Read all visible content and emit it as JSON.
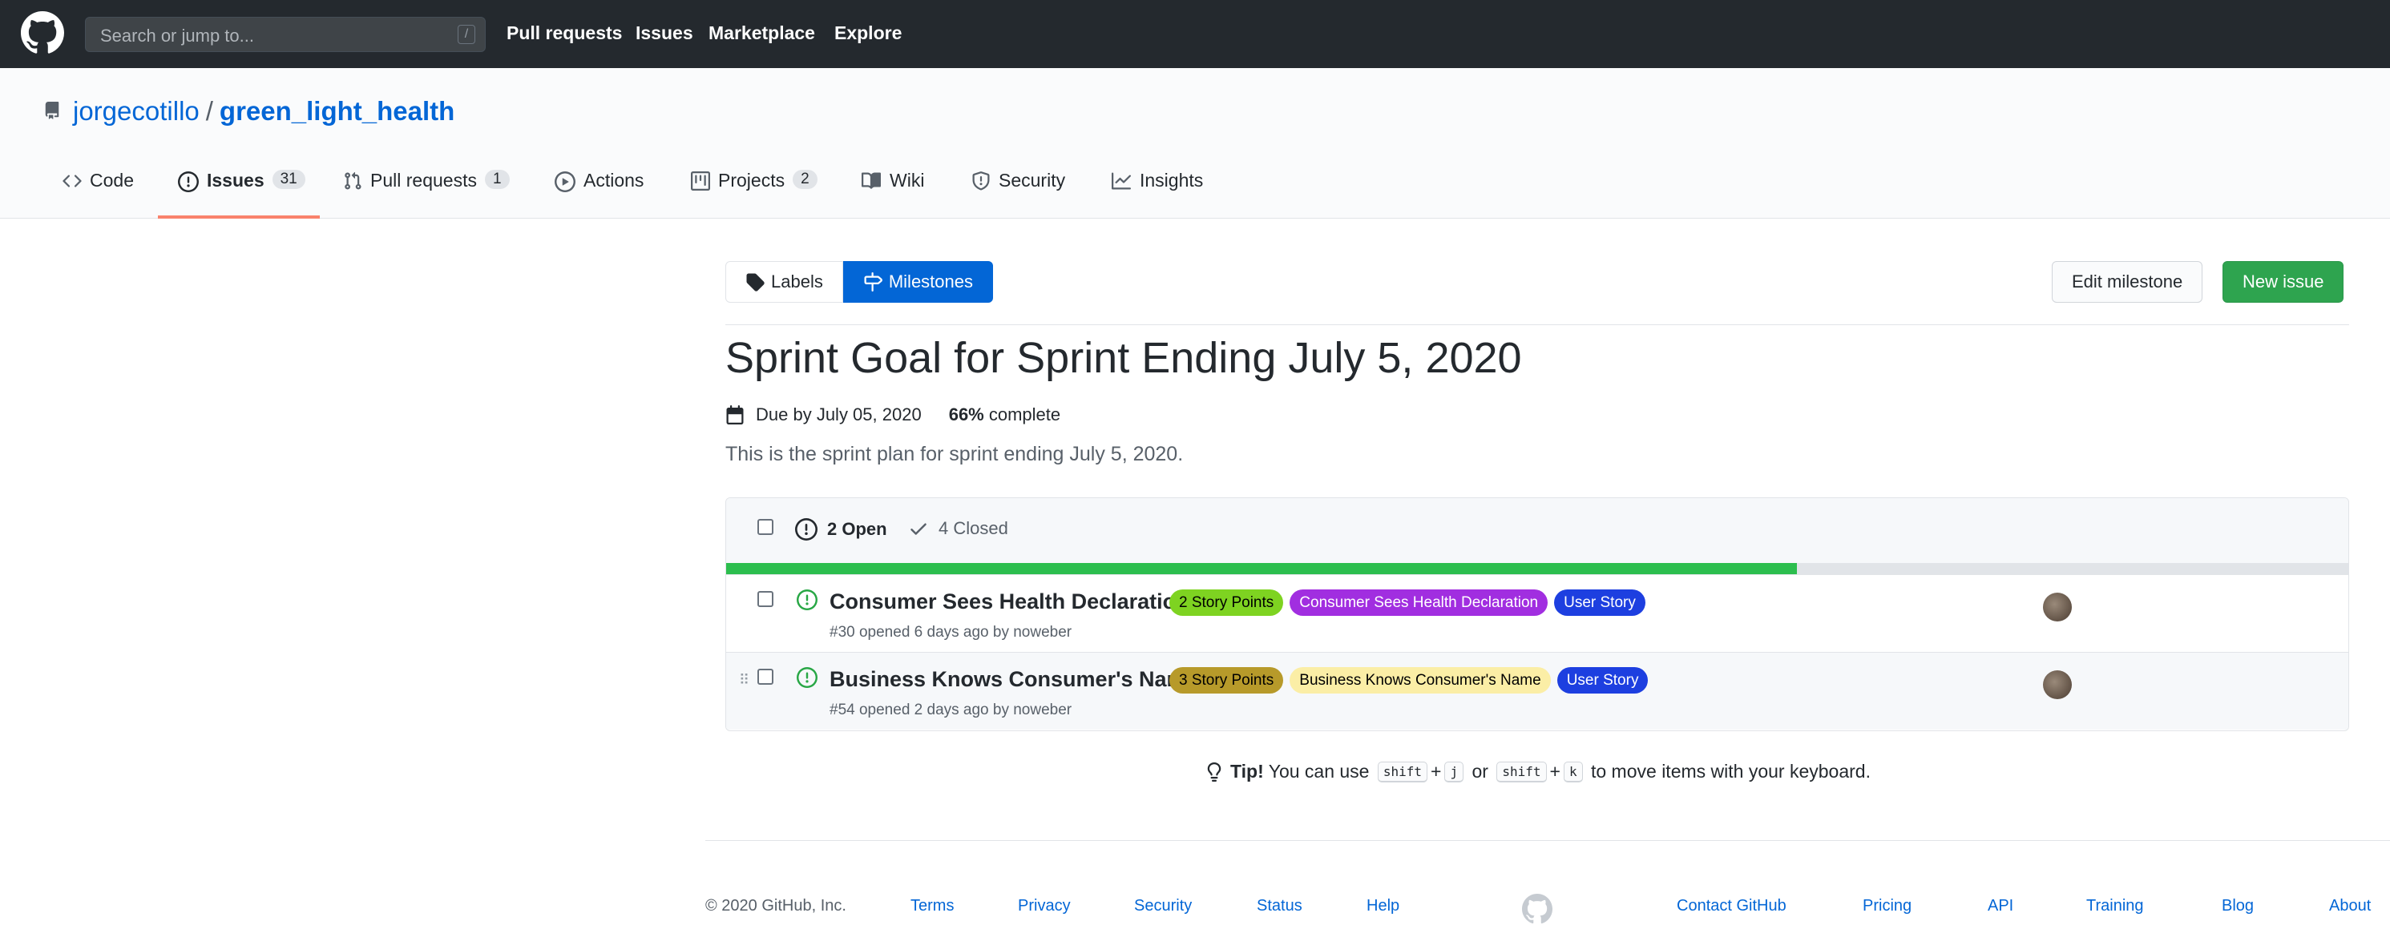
{
  "header": {
    "search_placeholder": "Search or jump to...",
    "search_shortcut": "/",
    "nav": [
      "Pull requests",
      "Issues",
      "Marketplace",
      "Explore"
    ]
  },
  "repo": {
    "owner": "jorgecotillo",
    "separator": "/",
    "name": "green_light_health"
  },
  "tabs": [
    {
      "label": "Code",
      "count": ""
    },
    {
      "label": "Issues",
      "count": "31"
    },
    {
      "label": "Pull requests",
      "count": "1"
    },
    {
      "label": "Actions",
      "count": ""
    },
    {
      "label": "Projects",
      "count": "2"
    },
    {
      "label": "Wiki",
      "count": ""
    },
    {
      "label": "Security",
      "count": ""
    },
    {
      "label": "Insights",
      "count": ""
    }
  ],
  "subnav": {
    "labels": "Labels",
    "milestones": "Milestones"
  },
  "buttons": {
    "edit_milestone": "Edit milestone",
    "new_issue": "New issue"
  },
  "milestone": {
    "title": "Sprint Goal for Sprint Ending July 5, 2020",
    "due": "Due by July 05, 2020",
    "percent": "66%",
    "percent_suffix": " complete",
    "percent_value": 0.66,
    "description": "This is the sprint plan for sprint ending July 5, 2020."
  },
  "states": {
    "open": "2 Open",
    "closed": "4 Closed"
  },
  "issues": [
    {
      "title": "Consumer Sees Health Declaration",
      "labels": [
        {
          "text": "2 Story Points",
          "bg": "#7ed321",
          "fg": "#000000"
        },
        {
          "text": "Consumer Sees Health Declaration",
          "bg": "#a12ee0",
          "fg": "#ffffff"
        },
        {
          "text": "User Story",
          "bg": "#1d3fe0",
          "fg": "#ffffff"
        }
      ],
      "meta": "#30 opened 6 days ago by noweber"
    },
    {
      "title": "Business Knows Consumer's Name",
      "labels": [
        {
          "text": "3 Story Points",
          "bg": "#b79a2a",
          "fg": "#000000"
        },
        {
          "text": "Business Knows Consumer's Name",
          "bg": "#fbeea6",
          "fg": "#000000"
        },
        {
          "text": "User Story",
          "bg": "#1d3fe0",
          "fg": "#ffffff"
        }
      ],
      "meta": "#54 opened 2 days ago by noweber"
    }
  ],
  "tip": {
    "bold": "Tip!",
    "text1": " You can use ",
    "key1": "shift",
    "plus": "+",
    "key2": "j",
    "or": " or ",
    "key3": "shift",
    "key4": "k",
    "text2": " to move items with your keyboard."
  },
  "footer": {
    "copyright": "© 2020 GitHub, Inc.",
    "left_links": [
      "Terms",
      "Privacy",
      "Security",
      "Status",
      "Help"
    ],
    "right_links": [
      "Contact GitHub",
      "Pricing",
      "API",
      "Training",
      "Blog",
      "About"
    ]
  },
  "colors": {
    "header_bg": "#24292e",
    "accent_blue": "#0366d6",
    "green": "#2ea44f",
    "tab_underline": "#f9826c",
    "progress": "#2cbe4e"
  }
}
